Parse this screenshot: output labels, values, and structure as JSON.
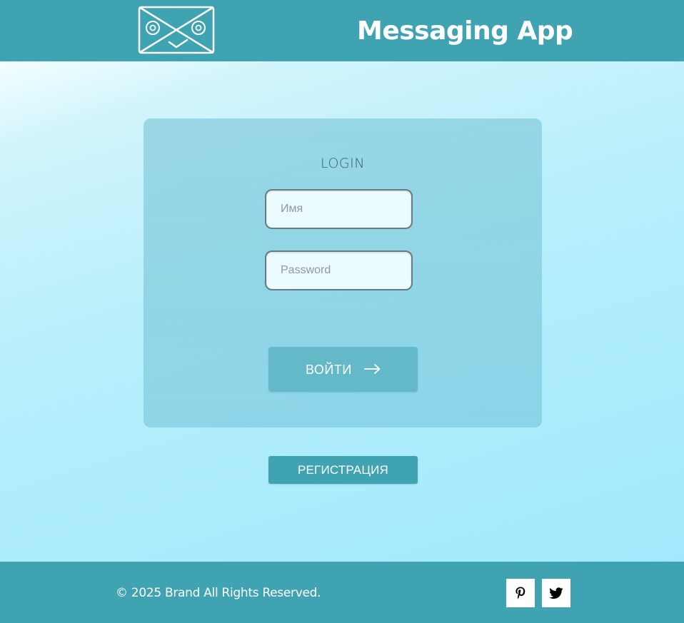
{
  "header": {
    "logo_icon": "envelope-face-icon",
    "title": "Messaging App"
  },
  "login": {
    "title": "LOGIN",
    "name_placeholder": "Имя",
    "name_value": "",
    "password_placeholder": "Password",
    "password_value": "",
    "submit_label": "ВОЙТИ",
    "submit_icon": "arrow-right-icon"
  },
  "register": {
    "label": "РЕГИСТРАЦИЯ"
  },
  "footer": {
    "copyright": "© 2025 Brand All Rights Reserved.",
    "social": [
      {
        "icon": "pinterest-icon"
      },
      {
        "icon": "twitter-icon"
      }
    ]
  },
  "colors": {
    "accent": "#40a3b2",
    "button": "#64b9c9",
    "background_top": "#f3feff",
    "background_bottom": "#a3e9fd"
  }
}
